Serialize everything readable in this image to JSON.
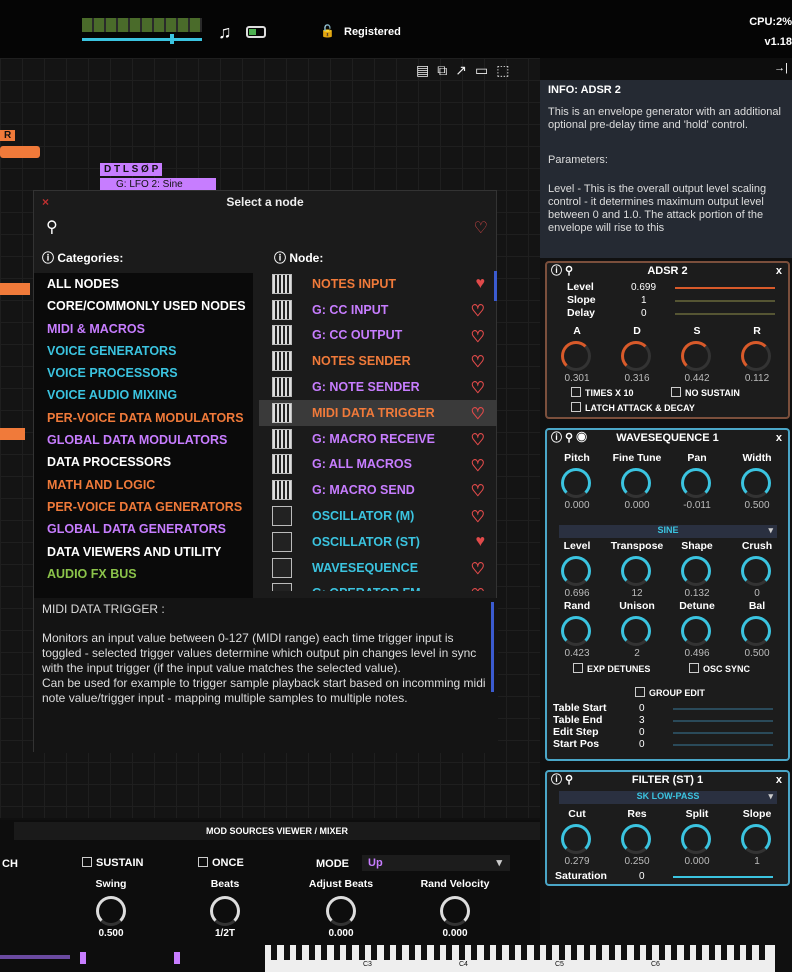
{
  "topbar": {
    "registered": "Registered",
    "cpu": "CPU:2%",
    "version": "v1.18"
  },
  "canvas": {
    "node_letters_1": "D T L S Ø P",
    "node_label_1": "G: LFO 2: Sine",
    "node_letters_2": "R"
  },
  "dialog": {
    "title": "Select a node",
    "categories_header": "Categories:",
    "node_header": "Node:",
    "categories": [
      {
        "label": "ALL NODES",
        "color": "#ffffff"
      },
      {
        "label": "CORE/COMMONLY USED NODES",
        "color": "#ffffff"
      },
      {
        "label": "MIDI & MACROS",
        "color": "#c77dff"
      },
      {
        "label": "VOICE GENERATORS",
        "color": "#3bc4e0"
      },
      {
        "label": "VOICE PROCESSORS",
        "color": "#3bc4e0"
      },
      {
        "label": "VOICE AUDIO MIXING",
        "color": "#3bc4e0"
      },
      {
        "label": "PER-VOICE DATA MODULATORS",
        "color": "#f07a3a"
      },
      {
        "label": "GLOBAL DATA MODULATORS",
        "color": "#c77dff"
      },
      {
        "label": "DATA PROCESSORS",
        "color": "#ffffff"
      },
      {
        "label": "MATH AND LOGIC",
        "color": "#f07a3a"
      },
      {
        "label": "PER-VOICE DATA GENERATORS",
        "color": "#f07a3a"
      },
      {
        "label": "GLOBAL DATA GENERATORS",
        "color": "#c77dff"
      },
      {
        "label": "DATA VIEWERS AND UTILITY",
        "color": "#ffffff"
      },
      {
        "label": "AUDIO FX BUS",
        "color": "#8bc34a"
      }
    ],
    "nodes": [
      {
        "label": "NOTES INPUT",
        "color": "#f07a3a",
        "fav": true
      },
      {
        "label": "G: CC INPUT",
        "color": "#c77dff",
        "fav": false
      },
      {
        "label": "G: CC OUTPUT",
        "color": "#c77dff",
        "fav": false
      },
      {
        "label": "NOTES SENDER",
        "color": "#f07a3a",
        "fav": false
      },
      {
        "label": "G: NOTE SENDER",
        "color": "#c77dff",
        "fav": false
      },
      {
        "label": "MIDI DATA TRIGGER",
        "color": "#f07a3a",
        "fav": false
      },
      {
        "label": "G: MACRO RECEIVE",
        "color": "#c77dff",
        "fav": false
      },
      {
        "label": "G: ALL MACROS",
        "color": "#c77dff",
        "fav": false
      },
      {
        "label": "G: MACRO SEND",
        "color": "#c77dff",
        "fav": false
      },
      {
        "label": "OSCILLATOR (M)",
        "color": "#3bc4e0",
        "fav": false
      },
      {
        "label": "OSCILLATOR (ST)",
        "color": "#3bc4e0",
        "fav": true
      },
      {
        "label": "WAVESEQUENCE",
        "color": "#3bc4e0",
        "fav": false
      },
      {
        "label": "G: OPERATOR FM",
        "color": "#3bc4e0",
        "fav": false
      }
    ],
    "desc_title": "MIDI DATA TRIGGER :",
    "desc_1": "Monitors an input value between 0-127 (MIDI range) each time trigger input is toggled - selected trigger values determine which output pin changes level in sync with the input trigger (if the input value matches the selected value).",
    "desc_2": "Can be used for example to trigger sample playback start based on incomming midi note value/trigger input - mapping multiple samples to multiple notes."
  },
  "info": {
    "title": "INFO:  ADSR 2",
    "p1": "This is an envelope generator with an additional optional pre-delay time and 'hold' control.",
    "p2": "Parameters:",
    "p3": "Level - This is the overall output level scaling control - it determines maximum output level between 0 and 1.0. The attack portion of the envelope will rise to this"
  },
  "adsr": {
    "title": "ADSR 2",
    "level_l": "Level",
    "level_v": "0.699",
    "slope_l": "Slope",
    "slope_v": "1",
    "delay_l": "Delay",
    "delay_v": "0",
    "knobs": [
      {
        "l": "A",
        "v": "0.301"
      },
      {
        "l": "D",
        "v": "0.316"
      },
      {
        "l": "S",
        "v": "0.442"
      },
      {
        "l": "R",
        "v": "0.112"
      }
    ],
    "times": "TIMES X 10",
    "nosustain": "NO SUSTAIN",
    "latch": "LATCH ATTACK & DECAY"
  },
  "wave": {
    "title": "WAVESEQUENCE 1",
    "row1": [
      {
        "l": "Pitch",
        "v": "0.000"
      },
      {
        "l": "Fine Tune",
        "v": "0.000"
      },
      {
        "l": "Pan",
        "v": "-0.011"
      },
      {
        "l": "Width",
        "v": "0.500"
      }
    ],
    "wave_sel": "SINE",
    "row2": [
      {
        "l": "Level",
        "v": "0.696"
      },
      {
        "l": "Transpose",
        "v": "12"
      },
      {
        "l": "Shape",
        "v": "0.132"
      },
      {
        "l": "Crush",
        "v": "0"
      }
    ],
    "row3": [
      {
        "l": "Rand",
        "v": "0.423"
      },
      {
        "l": "Unison",
        "v": "2"
      },
      {
        "l": "Detune",
        "v": "0.496"
      },
      {
        "l": "Bal",
        "v": "0.500"
      }
    ],
    "exp": "EXP DETUNES",
    "osc": "OSC SYNC",
    "group": "GROUP EDIT",
    "table": [
      {
        "l": "Table Start",
        "v": "0"
      },
      {
        "l": "Table End",
        "v": "3"
      },
      {
        "l": "Edit Step",
        "v": "0"
      },
      {
        "l": "Start Pos",
        "v": "0"
      }
    ]
  },
  "filter": {
    "title": "FILTER (ST) 1",
    "type": "SK LOW-PASS",
    "knobs": [
      {
        "l": "Cut",
        "v": "0.279"
      },
      {
        "l": "Res",
        "v": "0.250"
      },
      {
        "l": "Split",
        "v": "0.000"
      },
      {
        "l": "Slope",
        "v": "1"
      }
    ],
    "sat_l": "Saturation",
    "sat_v": "0"
  },
  "bottom": {
    "mixer": "MOD SOURCES VIEWER / MIXER",
    "ch": "CH",
    "sustain": "SUSTAIN",
    "once": "ONCE",
    "mode_l": "MODE",
    "mode_v": "Up",
    "knobs": [
      {
        "l": "Swing",
        "v": "0.500"
      },
      {
        "l": "Beats",
        "v": "1/2T"
      },
      {
        "l": "Adjust Beats",
        "v": "0.000"
      },
      {
        "l": "Rand Velocity",
        "v": "0.000"
      }
    ],
    "keys": [
      "C3",
      "C4",
      "C5",
      "C6"
    ]
  }
}
